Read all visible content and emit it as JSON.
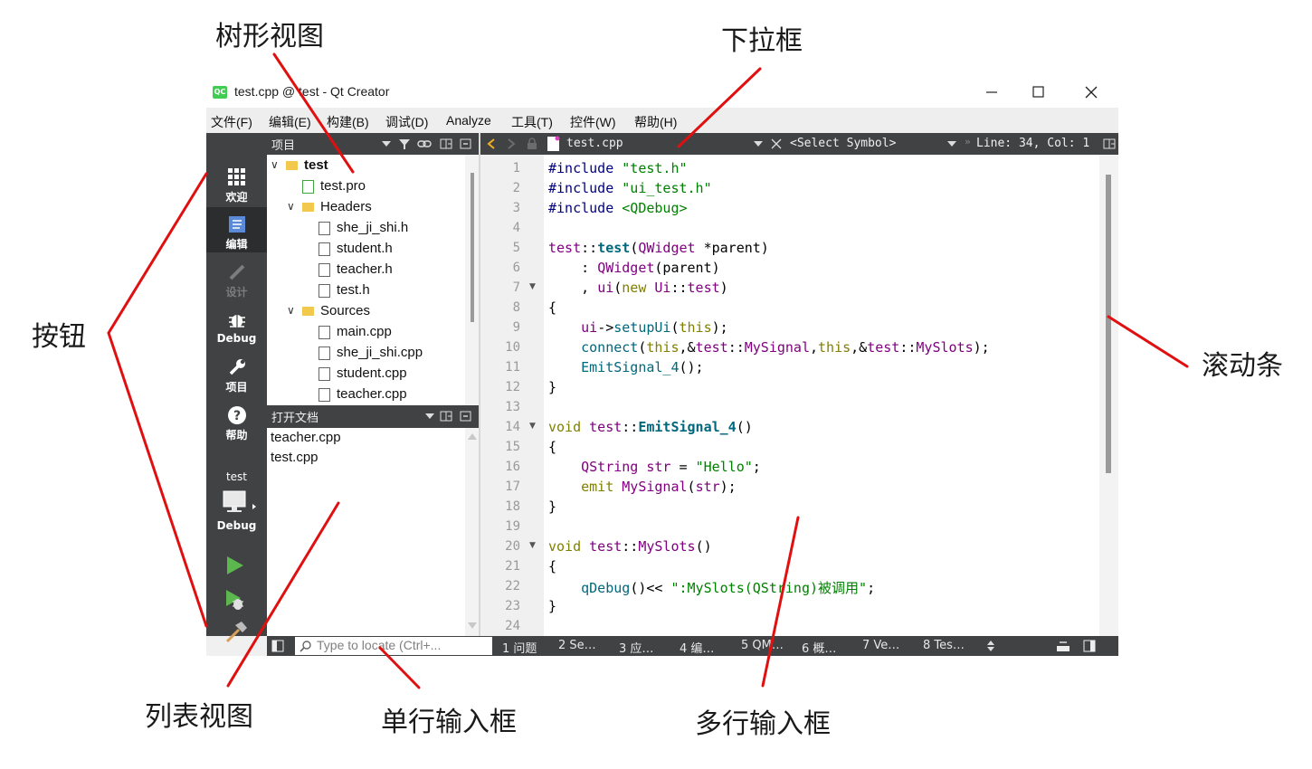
{
  "annotations": {
    "tree_view": "树形视图",
    "dropdown": "下拉框",
    "buttons": "按钮",
    "scrollbar": "滚动条",
    "list_view": "列表视图",
    "line_edit": "单行输入框",
    "text_edit": "多行输入框"
  },
  "window": {
    "title": "test.cpp @ test - Qt Creator",
    "logo": "QC",
    "minimize_icon": "minimize-icon",
    "maximize_icon": "maximize-icon",
    "close_icon": "close-icon"
  },
  "menu": [
    "文件(F)",
    "编辑(E)",
    "构建(B)",
    "调试(D)",
    "Analyze",
    "工具(T)",
    "控件(W)",
    "帮助(H)"
  ],
  "modes": [
    {
      "label": "欢迎",
      "icon": "grid-icon",
      "state": "normal"
    },
    {
      "label": "编辑",
      "icon": "edit-doc-icon",
      "state": "active"
    },
    {
      "label": "设计",
      "icon": "pencil-icon",
      "state": "disabled"
    },
    {
      "label": "Debug",
      "icon": "bug-icon",
      "state": "normal"
    },
    {
      "label": "项目",
      "icon": "wrench-icon",
      "state": "normal"
    },
    {
      "label": "帮助",
      "icon": "help-icon",
      "state": "normal"
    }
  ],
  "kit": {
    "project": "test",
    "config": "Debug"
  },
  "project_pane": {
    "title": "项目",
    "tree": [
      {
        "label": "test",
        "level": 0,
        "type": "project",
        "expanded": true,
        "bold": true
      },
      {
        "label": "test.pro",
        "level": 1,
        "type": "pro"
      },
      {
        "label": "Headers",
        "level": 1,
        "type": "folder-h",
        "expanded": true
      },
      {
        "label": "she_ji_shi.h",
        "level": 2,
        "type": "header"
      },
      {
        "label": "student.h",
        "level": 2,
        "type": "header"
      },
      {
        "label": "teacher.h",
        "level": 2,
        "type": "header"
      },
      {
        "label": "test.h",
        "level": 2,
        "type": "header"
      },
      {
        "label": "Sources",
        "level": 1,
        "type": "folder-cpp",
        "expanded": true
      },
      {
        "label": "main.cpp",
        "level": 2,
        "type": "source"
      },
      {
        "label": "she_ji_shi.cpp",
        "level": 2,
        "type": "source"
      },
      {
        "label": "student.cpp",
        "level": 2,
        "type": "source"
      },
      {
        "label": "teacher.cpp",
        "level": 2,
        "type": "source"
      }
    ]
  },
  "open_docs": {
    "title": "打开文档",
    "items": [
      "teacher.cpp",
      "test.cpp"
    ]
  },
  "editor": {
    "file": "test.cpp",
    "symbol": "<Select Symbol>",
    "position": "Line: 34, Col: 1",
    "lines": [
      "#include \"test.h\"",
      "#include \"ui_test.h\"",
      "#include <QDebug>",
      "",
      "test::test(QWidget *parent)",
      "    : QWidget(parent)",
      "    , ui(new Ui::test)",
      "{",
      "    ui->setupUi(this);",
      "    connect(this,&test::MySignal,this,&test::MySlots);",
      "    EmitSignal_4();",
      "}",
      "",
      "void test::EmitSignal_4()",
      "{",
      "    QString str = \"Hello\";",
      "    emit MySignal(str);",
      "}",
      "",
      "void test::MySlots()",
      "{",
      "    qDebug()<< \":MySlots(QString)被调用\";",
      "}",
      ""
    ],
    "folds": [
      7,
      14,
      20
    ]
  },
  "statusbar": {
    "locator_placeholder": "Type to locate (Ctrl+...",
    "tabs": [
      "1 问题",
      "2 Se…",
      "3 应…",
      "4 编…",
      "5 QM…",
      "6 概…",
      "7 Ve…",
      "8 Tes…"
    ]
  },
  "colors": {
    "annotation_arrow": "#e01010",
    "sidebar": "#404244",
    "keyword": "#808000",
    "type": "#800080",
    "string": "#008000",
    "function": "#00677c"
  }
}
